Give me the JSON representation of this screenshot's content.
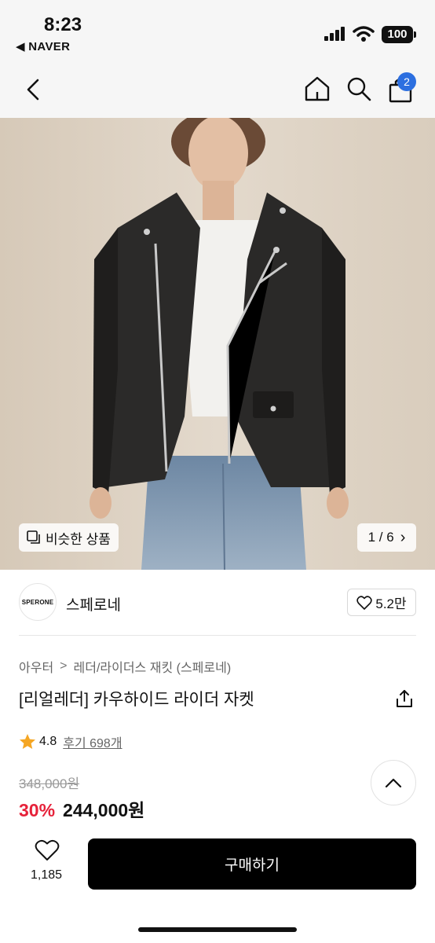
{
  "status_bar": {
    "time": "8:23",
    "back_app": "◀ NAVER",
    "battery": "100"
  },
  "navbar": {
    "icons": [
      "back-chevron-icon",
      "home-icon",
      "search-icon",
      "shopping-bag-icon"
    ],
    "cart_count": "2"
  },
  "hero": {
    "similar_label": "비슷한 상품",
    "page_indicator": "1 / 6",
    "page_chevron": "›"
  },
  "brand": {
    "logo_text": "SPERONE",
    "name": "스페로네",
    "likes": "5.2만"
  },
  "breadcrumb": {
    "category": "아우터",
    "separator": ">",
    "subcategory": "레더/라이더스 재킷 (스페로네)"
  },
  "product": {
    "title": "[리얼레더] 카우하이드 라이더 자켓",
    "rating": "4.8",
    "reviews": "후기 698개",
    "original_price": "348,000원",
    "discount": "30%",
    "price": "244,000원"
  },
  "bottom_bar": {
    "wish_count": "1,185",
    "buy_label": "구매하기"
  },
  "colors": {
    "accent_blue": "#2c6fe0",
    "discount_red": "#e6223a",
    "star": "#f5a623",
    "buy_button": "#000000"
  }
}
